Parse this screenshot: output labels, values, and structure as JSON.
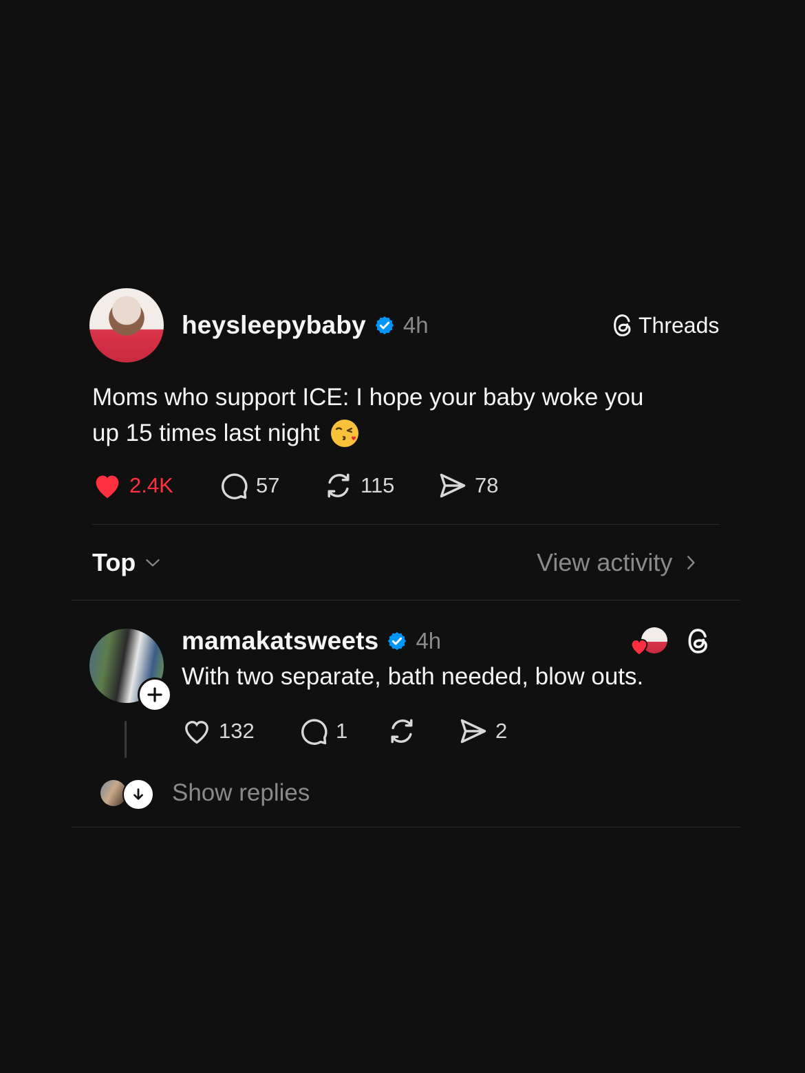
{
  "post": {
    "username": "heysleepybaby",
    "time": "4h",
    "brand_label": "Threads",
    "text_line1": "Moms who support ICE: I hope your baby woke you",
    "text_line2": "up 15 times last night",
    "emoji": "😘",
    "likes": "2.4K",
    "comments": "57",
    "reposts": "115",
    "shares": "78",
    "liked": true
  },
  "sort": {
    "label": "Top",
    "view_activity": "View activity"
  },
  "reply": {
    "username": "mamakatsweets",
    "time": "4h",
    "text": "With two separate, bath needed, blow outs.",
    "likes": "132",
    "comments": "1",
    "shares": "2"
  },
  "show_replies": {
    "label": "Show replies"
  },
  "colors": {
    "background": "#101010",
    "like_red": "#ff3040",
    "verified_blue": "#0095f6",
    "muted": "#8a8a8a",
    "divider": "#2a2a2a"
  },
  "icons": [
    "verified-badge-icon",
    "threads-logo-icon",
    "heart-filled-icon",
    "comment-icon",
    "repost-icon",
    "share-icon",
    "chevron-down-icon",
    "chevron-right-icon",
    "plus-icon",
    "heart-outline-icon",
    "arrow-down-icon"
  ]
}
